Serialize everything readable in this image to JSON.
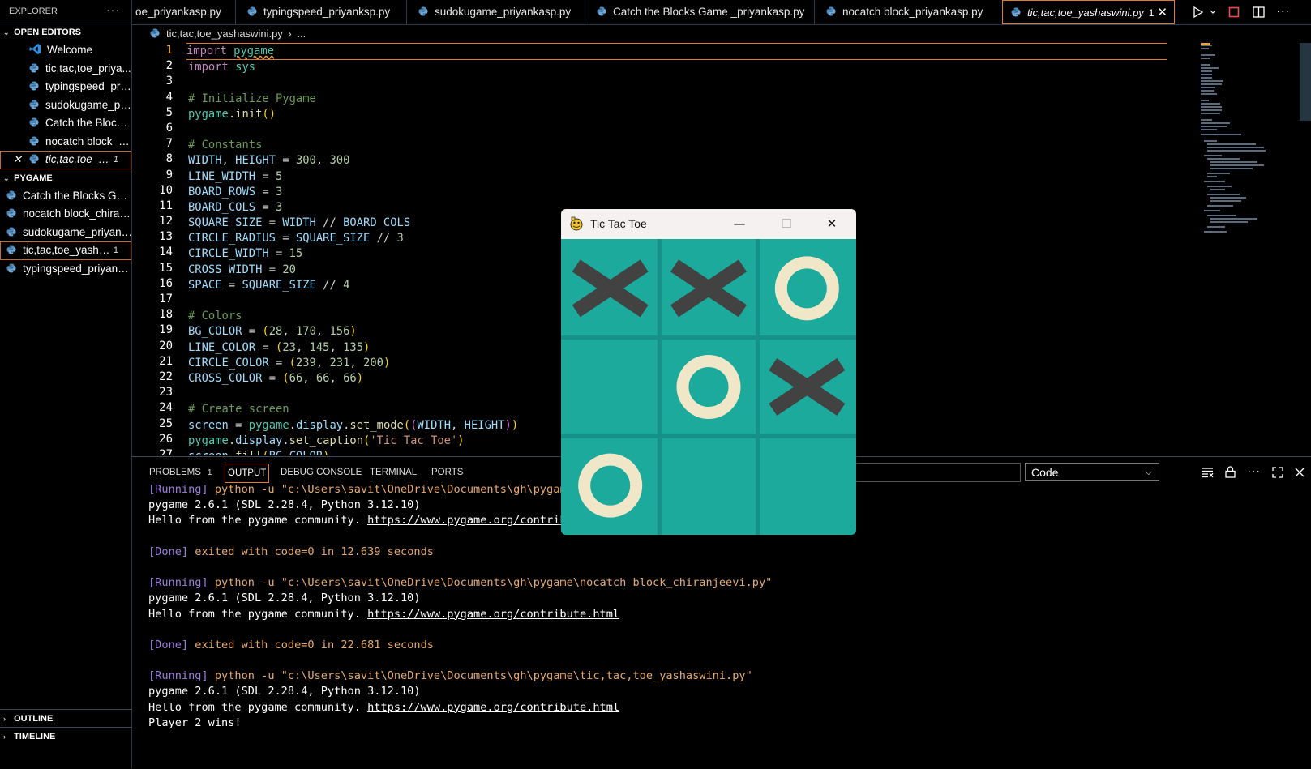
{
  "sidebar": {
    "title": "EXPLORER",
    "more": "···",
    "open_editors_label": "OPEN EDITORS",
    "open_editors": [
      {
        "label": "Welcome",
        "icon": "vscode-icon"
      },
      {
        "label": "tic,tac,toe_priya...",
        "icon": "python-icon"
      },
      {
        "label": "typingspeed_pri...",
        "icon": "python-icon"
      },
      {
        "label": "sudokugame_pri...",
        "icon": "python-icon"
      },
      {
        "label": "Catch the Blocks...",
        "icon": "python-icon"
      },
      {
        "label": "nocatch block_p...",
        "icon": "python-icon"
      },
      {
        "label": "tic,tac,toe_y...",
        "icon": "python-icon",
        "badge": "1",
        "close": "✕"
      }
    ],
    "folder_label": "PYGAME",
    "files": [
      {
        "label": "Catch the Blocks Gam..."
      },
      {
        "label": "nocatch block_chiranj..."
      },
      {
        "label": "sudokugame_priyank..."
      },
      {
        "label": "tic,tac,toe_yashas...",
        "badge": "1"
      },
      {
        "label": "typingspeed_priyanks..."
      }
    ],
    "outline_label": "OUTLINE",
    "timeline_label": "TIMELINE"
  },
  "tabs": [
    {
      "label": "oe_priyankasp.py"
    },
    {
      "label": "typingspeed_priyanksp.py"
    },
    {
      "label": "sudokugame_priyankasp.py"
    },
    {
      "label": "Catch the Blocks Game _priyankasp.py"
    },
    {
      "label": "nocatch block_priyankasp.py"
    },
    {
      "label": "tic,tac,toe_yashaswini.py",
      "badge": "1",
      "close": "✕",
      "active": true
    }
  ],
  "breadcrumb": {
    "file": "tic,tac,toe_yashaswini.py",
    "sep": "›",
    "rest": "..."
  },
  "editor": {
    "line_numbers": [
      "1",
      "2",
      "3",
      "4",
      "5",
      "6",
      "7",
      "8",
      "9",
      "10",
      "11",
      "12",
      "13",
      "14",
      "15",
      "16",
      "17",
      "18",
      "19",
      "20",
      "21",
      "22",
      "23",
      "24",
      "25",
      "26",
      "27"
    ],
    "current_line": "1"
  },
  "panel": {
    "tabs": [
      {
        "label": "PROBLEMS",
        "badge": "1"
      },
      {
        "label": "OUTPUT",
        "active": true
      },
      {
        "label": "DEBUG CONSOLE"
      },
      {
        "label": "TERMINAL"
      },
      {
        "label": "PORTS"
      }
    ],
    "output_channel": "Code",
    "output": {
      "l1_tag": "[Running]",
      "l1_cmd": " python -u \"c:\\Users\\savit\\OneDrive\\Documents\\gh\\pygame\\n",
      "l2": "pygame 2.6.1 (SDL 2.28.4, Python 3.12.10)",
      "l3_pre": "Hello from the pygame community. ",
      "l3_link": "https://www.pygame.org/contribute",
      "l5_tag": "[Done]",
      "l5_a": " exited with ",
      "l5_code": "code=0",
      "l5_b": " in 12.639 seconds",
      "l7_tag": "[Running]",
      "l7_cmd": " python -u \"c:\\Users\\savit\\OneDrive\\Documents\\gh\\pygame\\nocatch block_chiranjeevi.py\"",
      "l8": "pygame 2.6.1 (SDL 2.28.4, Python 3.12.10)",
      "l9_pre": "Hello from the pygame community. ",
      "l9_link": "https://www.pygame.org/contribute.html",
      "l11_tag": "[Done]",
      "l11_a": " exited with ",
      "l11_code": "code=0",
      "l11_b": " in 22.681 seconds",
      "l13_tag": "[Running]",
      "l13_cmd": " python -u \"c:\\Users\\savit\\OneDrive\\Documents\\gh\\pygame\\tic,tac,toe_yashaswini.py\"",
      "l14": "pygame 2.6.1 (SDL 2.28.4, Python 3.12.10)",
      "l15_pre": "Hello from the pygame community. ",
      "l15_link": "https://www.pygame.org/contribute.html",
      "l16": "Player 2 wins!"
    }
  },
  "game": {
    "title": "Tic Tac Toe",
    "minimize": "—",
    "maximize": "☐",
    "close": "✕",
    "board": [
      [
        "X",
        "X",
        "O"
      ],
      [
        "",
        "O",
        "X"
      ],
      [
        "O",
        "",
        ""
      ]
    ],
    "colors": {
      "bg": "#1caa9c",
      "line": "#17918 7",
      "circle": "#efe7c8",
      "cross": "#424242"
    }
  },
  "colors": {
    "accent": "#e07b2a",
    "background": "#000000"
  }
}
